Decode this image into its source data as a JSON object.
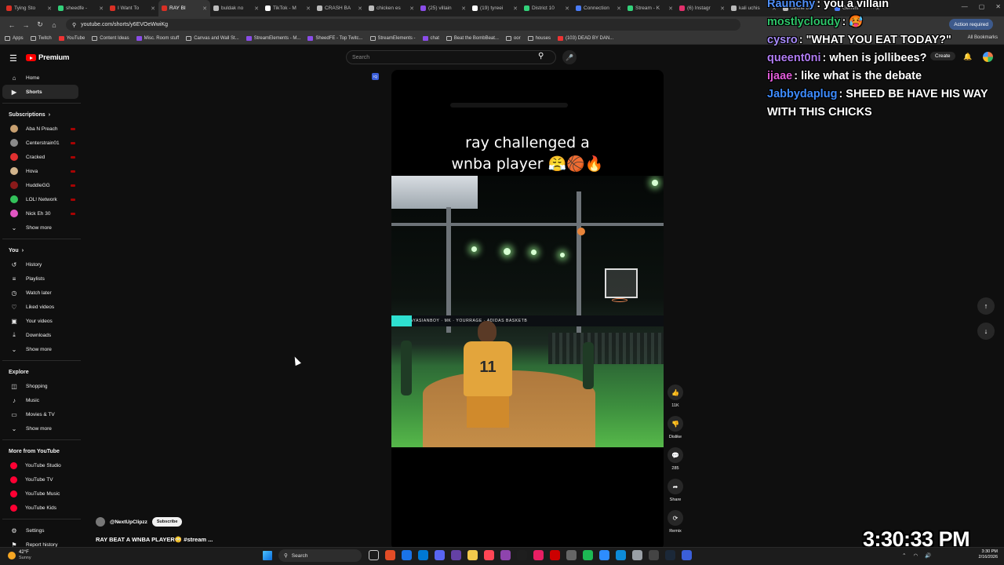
{
  "browser": {
    "tabs": [
      {
        "label": "Tying Sto",
        "color": "#d93025"
      },
      {
        "label": "sheedfe -",
        "color": "#33d17a"
      },
      {
        "label": "I Want To",
        "color": "#d93025"
      },
      {
        "label": "RAY BI",
        "color": "#d93025",
        "active": true
      },
      {
        "label": "buldak no",
        "color": "#bbbbbb"
      },
      {
        "label": "TikTok - M",
        "color": "#ffffff"
      },
      {
        "label": "CRASH BA",
        "color": "#bbbbbb"
      },
      {
        "label": "chicken es",
        "color": "#bbbbbb"
      },
      {
        "label": "(25) villain",
        "color": "#8a4de8"
      },
      {
        "label": "(19) tyreei",
        "color": "#ffffff"
      },
      {
        "label": "District 10",
        "color": "#33d17a"
      },
      {
        "label": "Connection",
        "color": "#4a7cf7"
      },
      {
        "label": "Stream - K",
        "color": "#33d17a"
      },
      {
        "label": "(6) Instagr",
        "color": "#e1306c"
      },
      {
        "label": "kali uchis",
        "color": "#bbbbbb"
      },
      {
        "label": "define bo",
        "color": "#bbbbbb"
      },
      {
        "label": "Gemini",
        "color": "#4a7cf7"
      }
    ],
    "url": "youtube.com/shorts/y6EVOeWwiKg",
    "action_required": "Action required",
    "bookmarks": [
      "Apps",
      "Twitch",
      "YouTube",
      "Content Ideas",
      "Misc. Room stuff",
      "Canvas and Wall St...",
      "StreamElements - M...",
      "SheedFE - Top Twitc...",
      "StreamElements -",
      "chat",
      "Beat the BombBeat...",
      "oor",
      "houses",
      "(103) DEAD BY DAN..."
    ],
    "all_bookmarks": "All Bookmarks"
  },
  "youtube": {
    "logo_text": "Premium",
    "search_placeholder": "Search",
    "create_label": "Create",
    "sidebar": {
      "primary": [
        {
          "label": "Home",
          "icon": "⌂"
        },
        {
          "label": "Shorts",
          "icon": "▶",
          "active": true
        }
      ],
      "subscriptions_title": "Subscriptions",
      "subscriptions": [
        {
          "label": "Aba N Preach",
          "color": "#c8a070"
        },
        {
          "label": "Centerstrain01",
          "color": "#8a8a8a"
        },
        {
          "label": "Cracked",
          "color": "#e03030"
        },
        {
          "label": "Hova",
          "color": "#d2b48c"
        },
        {
          "label": "HuddleGG",
          "color": "#8b1a1a"
        },
        {
          "label": "LOL! Network",
          "color": "#33c15a"
        },
        {
          "label": "Nick Eh 30",
          "color": "#e056c2"
        }
      ],
      "subscriptions_more": "Show more",
      "you_title": "You",
      "you": [
        {
          "label": "History",
          "icon": "↺"
        },
        {
          "label": "Playlists",
          "icon": "≡"
        },
        {
          "label": "Watch later",
          "icon": "◷"
        },
        {
          "label": "Liked videos",
          "icon": "♡"
        },
        {
          "label": "Your videos",
          "icon": "▣"
        },
        {
          "label": "Downloads",
          "icon": "⤓"
        }
      ],
      "you_more": "Show more",
      "explore_title": "Explore",
      "explore": [
        {
          "label": "Shopping",
          "icon": "◫"
        },
        {
          "label": "Music",
          "icon": "♪"
        },
        {
          "label": "Movies & TV",
          "icon": "▭"
        }
      ],
      "explore_more": "Show more",
      "more_title": "More from YouTube",
      "more": [
        {
          "label": "YouTube Studio"
        },
        {
          "label": "YouTube TV"
        },
        {
          "label": "YouTube Music"
        },
        {
          "label": "YouTube Kids"
        }
      ],
      "footer": [
        {
          "label": "Settings",
          "icon": "⚙"
        },
        {
          "label": "Report history",
          "icon": "⚑"
        }
      ]
    },
    "short": {
      "caption_line1": "ray challenged a",
      "caption_line2": "wnba player 😤🏀🔥",
      "banner_text": "KAYASIANBOY · MK · YOURRAGE · ADIDAS BASKETB",
      "jersey_number": "11",
      "likes": "11K",
      "dislike_label": "Dislike",
      "comments": "285",
      "share_label": "Share",
      "remix_label": "Remix",
      "channel": "@NextUpClipzz",
      "subscribe_label": "Subscribe",
      "title": "RAY BEAT A WNBA PLAYER😳 #stream ..."
    }
  },
  "chat": [
    {
      "user": "Raunchy",
      "user_color": "#4e8ef7",
      "msg": "you a villain"
    },
    {
      "user": "mostlycloudy",
      "user_color": "#2fc46a",
      "msg": "🥵"
    },
    {
      "user": "cysro",
      "user_color": "#a78bfa",
      "msg": "\"WHAT YOU EAT TODAY?\""
    },
    {
      "user": "queent0ni",
      "user_color": "#b07cf2",
      "msg": "when is jollibees?"
    },
    {
      "user": "ijaae",
      "user_color": "#e05bd7",
      "msg": "like what is the debate"
    },
    {
      "user": "Jabbydaplug",
      "user_color": "#3d8bfd",
      "msg": "SHEED BE HAVE HIS WAY WITH THIS CHICKS"
    }
  ],
  "stream_clock": "3:30:33 PM",
  "taskbar": {
    "temp": "42°F",
    "condition": "Sunny",
    "search_label": "Search",
    "time": "3:30 PM",
    "date": "2/16/2026",
    "apps": [
      "#ffffff",
      "#e34c26",
      "#1a73e8",
      "#0078d4",
      "#5865f2",
      "#6441a5",
      "#f2c94c",
      "#ff4655",
      "#8e44ad",
      "#1e1e1e",
      "#e91e63",
      "#cc0000",
      "#666666",
      "#1db954",
      "#2d8cff",
      "#0d8bd8",
      "#9aa0a6",
      "#444444",
      "#1b2838",
      "#3b5fd9"
    ]
  },
  "colors": {
    "accent_red": "#ff0000",
    "bg": "#0f0f0f"
  }
}
